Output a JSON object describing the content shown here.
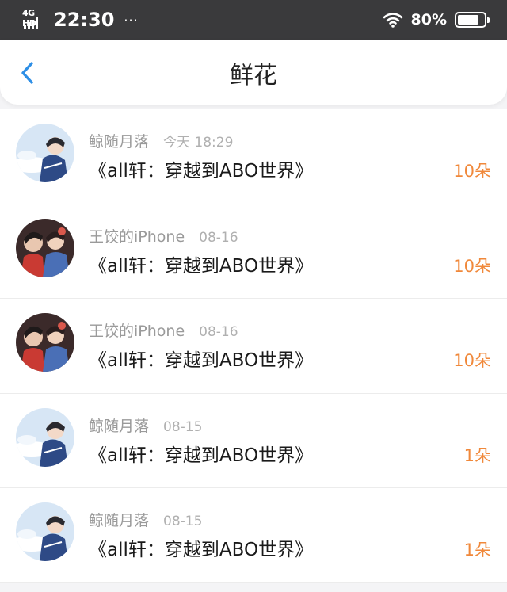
{
  "status_bar": {
    "network": "4G HD",
    "time": "22:30",
    "more": "···",
    "battery": "80%"
  },
  "header": {
    "title": "鲜花"
  },
  "flower_records": [
    {
      "user": "鲸随月落",
      "date": "今天 18:29",
      "book": "《all轩：穿越到ABO世界》",
      "count": "10朵",
      "avatar": "sky-avatar"
    },
    {
      "user": "王饺的iPhone",
      "date": "08-16",
      "book": "《all轩：穿越到ABO世界》",
      "count": "10朵",
      "avatar": "couple-avatar"
    },
    {
      "user": "王饺的iPhone",
      "date": "08-16",
      "book": "《all轩：穿越到ABO世界》",
      "count": "10朵",
      "avatar": "couple-avatar"
    },
    {
      "user": "鲸随月落",
      "date": "08-15",
      "book": "《all轩：穿越到ABO世界》",
      "count": "1朵",
      "avatar": "sky-avatar"
    },
    {
      "user": "鲸随月落",
      "date": "08-15",
      "book": "《all轩：穿越到ABO世界》",
      "count": "1朵",
      "avatar": "sky-avatar"
    }
  ],
  "colors": {
    "accent": "#f0883a",
    "back": "#2e8fe6",
    "status_bar": "#3a3a3c"
  }
}
